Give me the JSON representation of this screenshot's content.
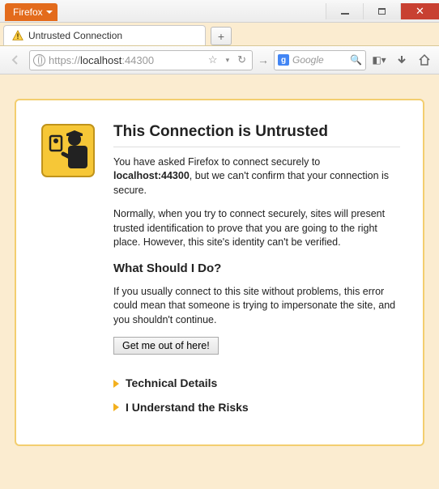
{
  "titlebar": {
    "menu": "Firefox"
  },
  "tab": {
    "title": "Untrusted Connection"
  },
  "url": {
    "protocol": "https://",
    "host": "localhost",
    "port": ":44300"
  },
  "search": {
    "placeholder": "Google"
  },
  "page": {
    "heading": "This Connection is Untrusted",
    "para1_a": "You have asked Firefox to connect securely to ",
    "para1_host": "localhost:44300",
    "para1_b": ", but we can't confirm that your connection is secure.",
    "para2": "Normally, when you try to connect securely, sites will present trusted identification to prove that you are going to the right place. However, this site's identity can't be verified.",
    "subheading": "What Should I Do?",
    "para3": "If you usually connect to this site without problems, this error could mean that someone is trying to impersonate the site, and you shouldn't continue.",
    "escape": "Get me out of here!",
    "expand1": "Technical Details",
    "expand2": "I Understand the Risks"
  }
}
